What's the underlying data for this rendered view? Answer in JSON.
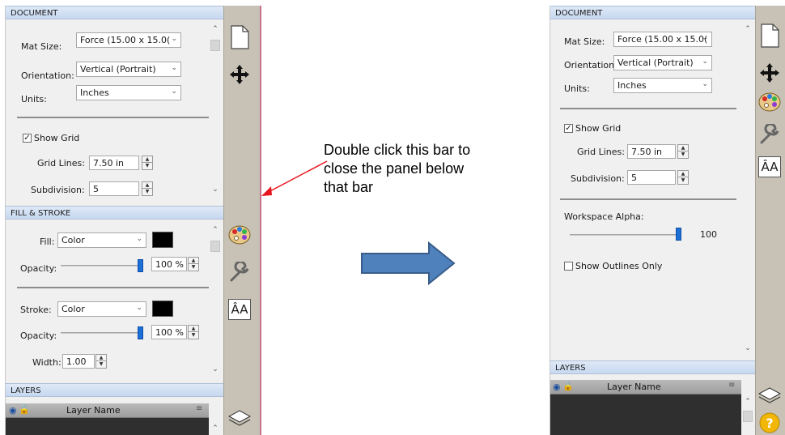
{
  "left_panel": {
    "document_header": "DOCUMENT",
    "mat_size_label": "Mat Size:",
    "mat_size_value": "Force (15.00 x 15.0(",
    "orientation_label": "Orientation:",
    "orientation_value": "Vertical (Portrait)",
    "units_label": "Units:",
    "units_value": "Inches",
    "show_grid_label": "Show Grid",
    "show_grid_checked": "✓",
    "grid_lines_label": "Grid Lines:",
    "grid_lines_value": "7.50 in",
    "subdivision_label": "Subdivision:",
    "subdivision_value": "5",
    "fill_stroke_header": "FILL & STROKE",
    "fill_label": "Fill:",
    "fill_value": "Color",
    "opacity_label": "Opacity:",
    "fill_opacity_value": "100 %",
    "stroke_label": "Stroke:",
    "stroke_value": "Color",
    "stroke_opacity_value": "100 %",
    "width_label": "Width:",
    "width_value": "1.00",
    "layers_header": "LAYERS",
    "layer_name_col": "Layer Name"
  },
  "annotation": {
    "text_line1": "Double click this bar to",
    "text_line2": "close the panel below",
    "text_line3": "that bar"
  },
  "right_panel": {
    "document_header": "DOCUMENT",
    "mat_size_label": "Mat Size:",
    "mat_size_value": "Force (15.00 x 15.0(",
    "orientation_label": "Orientation:",
    "orientation_value": "Vertical (Portrait)",
    "units_label": "Units:",
    "units_value": "Inches",
    "show_grid_label": "Show Grid",
    "show_grid_checked": "✓",
    "grid_lines_label": "Grid Lines:",
    "grid_lines_value": "7.50 in",
    "subdivision_label": "Subdivision:",
    "subdivision_value": "5",
    "workspace_alpha_label": "Workspace Alpha:",
    "workspace_alpha_value": "100",
    "show_outlines_label": "Show Outlines Only",
    "layers_header": "LAYERS",
    "layer_name_col": "Layer Name"
  },
  "icons": {
    "document": "document-icon",
    "move": "move-icon",
    "palette": "palette-icon",
    "wrench": "wrench-icon",
    "text": "text-size-icon",
    "layers": "layers-icon",
    "help": "help-icon"
  },
  "colors": {
    "arrow_blue": "#4f81bd",
    "annotation_red": "#e8141e",
    "slider_blue": "#1c6fd6",
    "sidebar": "#c7c2b5",
    "header_blue": "#c6d8f0"
  }
}
